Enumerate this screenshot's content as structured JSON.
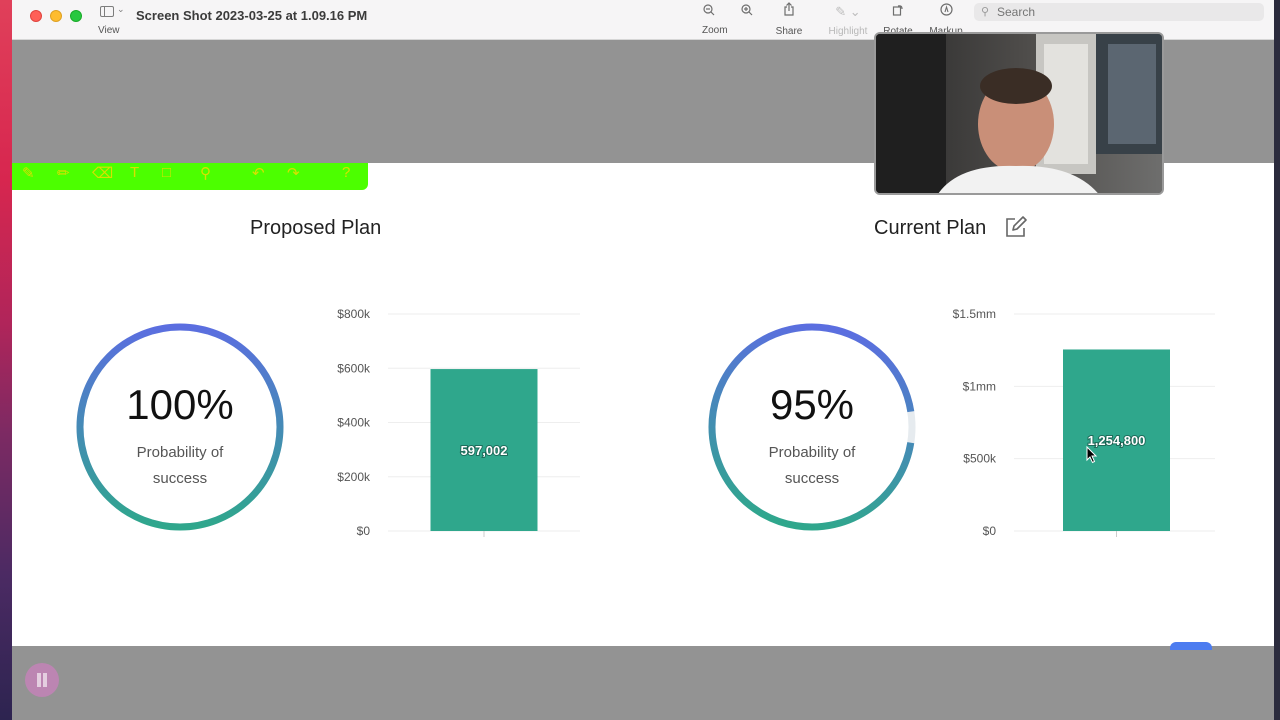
{
  "window": {
    "title": "Screen Shot 2023-03-25 at 1.09.16 PM",
    "view_label": "View"
  },
  "toolbar": {
    "zoom_label": "Zoom",
    "share_label": "Share",
    "highlight_label": "Highlight",
    "rotate_label": "Rotate",
    "markup_label": "Markup",
    "search_placeholder": "Search"
  },
  "proposed": {
    "title": "Proposed Plan",
    "probability": "100%",
    "probability_fraction": 1.0,
    "sub_line1": "Probability of",
    "sub_line2": "success"
  },
  "current": {
    "title": "Current Plan",
    "probability": "95%",
    "probability_fraction": 0.95,
    "sub_line1": "Probability of",
    "sub_line2": "success"
  },
  "chart_data": [
    {
      "type": "bar",
      "categories": [
        ""
      ],
      "values": [
        597002
      ],
      "data_labels": [
        "597,002"
      ],
      "ylim": [
        0,
        800000
      ],
      "y_ticks": [
        0,
        200000,
        400000,
        600000,
        800000
      ],
      "y_tick_labels": [
        "$0",
        "$200k",
        "$400k",
        "$600k",
        "$800k"
      ],
      "grid": true,
      "bar_color": "#2fa78c"
    },
    {
      "type": "bar",
      "categories": [
        ""
      ],
      "values": [
        1254800
      ],
      "data_labels": [
        "1,254,800"
      ],
      "ylim": [
        0,
        1500000
      ],
      "y_ticks": [
        0,
        500000,
        1000000,
        1500000
      ],
      "y_tick_labels": [
        "$0",
        "$500k",
        "$1mm",
        "$1.5mm"
      ],
      "grid": true,
      "bar_color": "#2fa78c"
    }
  ],
  "colors": {
    "gauge_start": "#5b6ee0",
    "gauge_end": "#2fa78c",
    "gauge_track": "#e6ebef",
    "annotation_bar": "#4cff00"
  }
}
